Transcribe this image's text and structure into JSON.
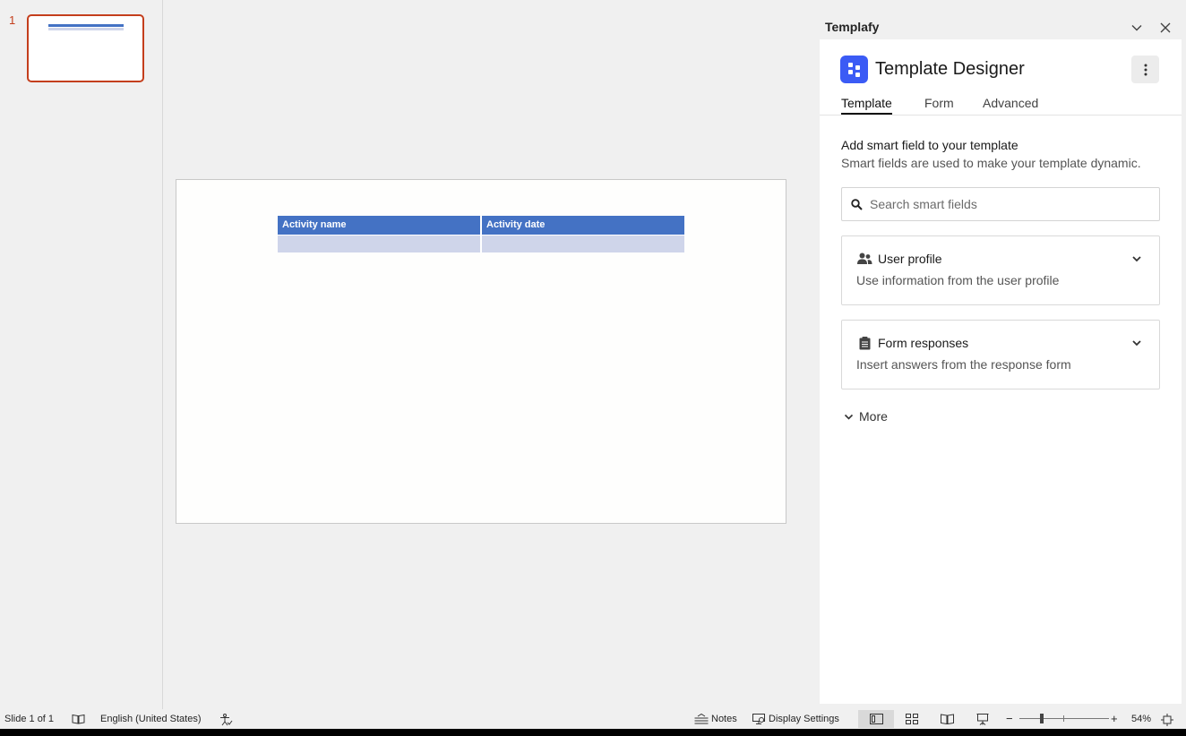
{
  "thumbnails": [
    {
      "number": "1"
    }
  ],
  "slide": {
    "table": {
      "headers": [
        "Activity name",
        "Activity date"
      ],
      "rows": [
        [
          "",
          ""
        ]
      ]
    }
  },
  "task_pane": {
    "header": "Templafy",
    "controls": {
      "collapse_icon": "chevron-down-icon",
      "close_icon": "close-icon"
    },
    "app_title": "Template Designer",
    "tabs": [
      {
        "label": "Template",
        "active": true
      },
      {
        "label": "Form",
        "active": false
      },
      {
        "label": "Advanced",
        "active": false
      }
    ],
    "section_title": "Add smart field to your template",
    "section_subtitle": "Smart fields are used to make your template dynamic.",
    "search": {
      "placeholder": "Search smart fields",
      "value": ""
    },
    "cards": [
      {
        "title": "User profile",
        "description": "Use information from the user profile",
        "icon": "users-icon"
      },
      {
        "title": "Form responses",
        "description": "Insert answers from the response form",
        "icon": "clipboard-icon"
      }
    ],
    "more_label": "More",
    "colors": {
      "logo": "#3b5bf5"
    }
  },
  "status_bar": {
    "slide_info": "Slide 1 of 1",
    "language": "English (United States)",
    "notes_label": "Notes",
    "display_settings_label": "Display Settings",
    "zoom": {
      "label": "54%",
      "value": 54
    }
  },
  "colors": {
    "accent": "#c43e1c",
    "table_header": "#4472c4",
    "table_row": "#cfd5ea"
  }
}
